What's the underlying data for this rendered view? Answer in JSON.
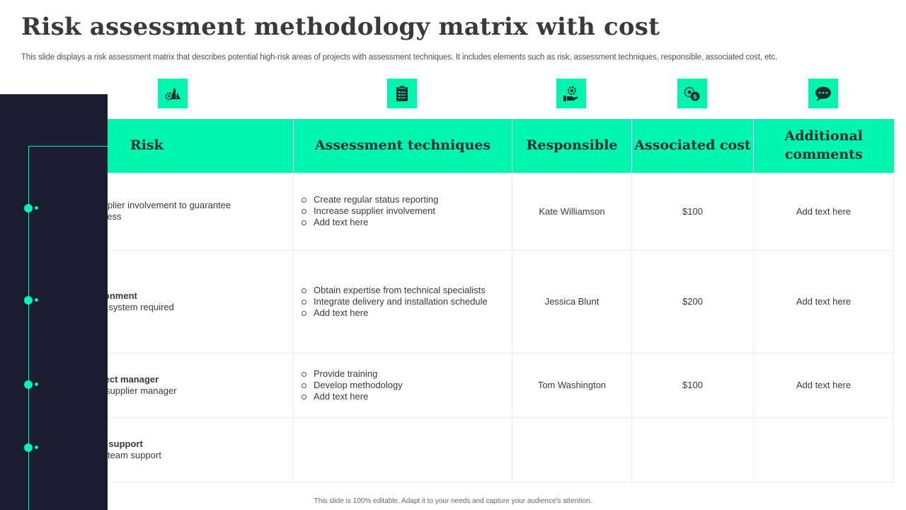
{
  "title": "Risk assessment methodology matrix with cost",
  "subtitle": "This slide displays a risk assessment matrix that describes potential high-risk areas of projects with assessment techniques. It includes elements such as risk, assessment techniques, responsible, associated cost, etc.",
  "icons": [
    "gear-warning-icon",
    "clipboard-icon",
    "hand-gear-icon",
    "coins-icon",
    "chat-bubble-icon"
  ],
  "colors": {
    "accent": "#00f5b0",
    "panel": "#1b1e31",
    "text": "#3a3a3a"
  },
  "headers": [
    "Risk",
    "Assessment techniques",
    "Responsible",
    "Associated cost",
    "Additional comments"
  ],
  "rows": [
    {
      "risk_title": "",
      "risk_desc": "supplier involvement  to guarantee",
      "risk_desc2": "uccess",
      "techniques": [
        "Create regular status reporting",
        "Increase supplier involvement",
        "Add text here"
      ],
      "responsible": "Kate Williamson",
      "cost": "$100",
      "comments": "Add text here"
    },
    {
      "risk_title": "vironment",
      "risk_desc": "are  system required",
      "risk_desc2": "",
      "techniques": [
        "Obtain expertise from technical specialists",
        "Integrate delivery  and installation schedule",
        "Add text here"
      ],
      "responsible": "Jessica Blunt",
      "cost": "$200",
      "comments": "Add text here"
    },
    {
      "risk_title": "roject manager",
      "risk_desc": "ed  supplier manager",
      "risk_desc2": "",
      "techniques": [
        "Provide  training",
        "Develop  methodology",
        "Add text here"
      ],
      "responsible": "Tom Washington",
      "cost": "$100",
      "comments": "Add text here"
    },
    {
      "risk_title": "am support",
      "risk_desc": "ect  team support",
      "risk_desc2": "",
      "techniques": [],
      "responsible": "",
      "cost": "",
      "comments": ""
    }
  ],
  "footer": "This slide is 100% editable.  Adapt it to your needs and capture your audience's attention."
}
